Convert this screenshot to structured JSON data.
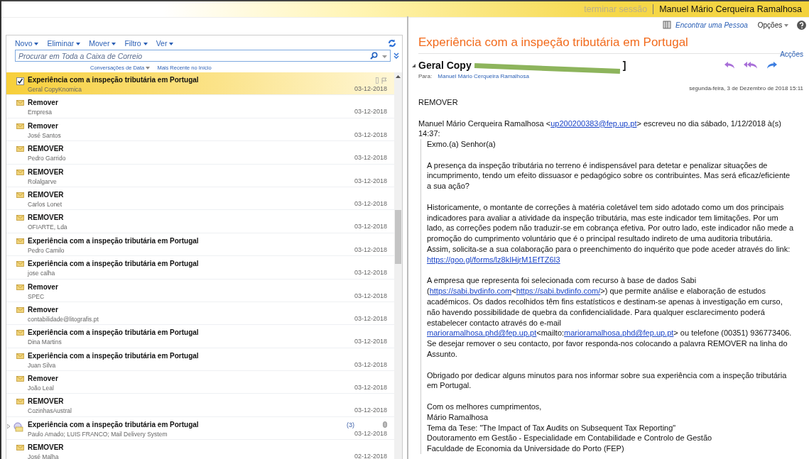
{
  "top_bar": {
    "sign_out": "terminar sessão",
    "user": "Manuel Mário Cerqueira Ramalhosa"
  },
  "header_links": {
    "find_person": "Encontrar uma Pessoa",
    "options": "Opções"
  },
  "toolbar": [
    "Novo",
    "Eliminar",
    "Mover",
    "Filtro",
    "Ver"
  ],
  "search": {
    "placeholder": "Procurar em Toda a Caixa de Correio"
  },
  "sort": {
    "arrange": "Conversações de Data",
    "order": "Mais Recente no Início"
  },
  "messages": [
    {
      "kind": "mail",
      "selected": true,
      "subject": "Experiência com a inspeção tributária em Portugal",
      "from": "Geral CopyKnomica",
      "date": "03-12-2018"
    },
    {
      "kind": "mail",
      "selected": false,
      "subject": "Remover",
      "from": "Empresa",
      "date": "03-12-2018"
    },
    {
      "kind": "mail",
      "selected": false,
      "subject": "Remover",
      "from": "José Santos",
      "date": "03-12-2018"
    },
    {
      "kind": "mail",
      "selected": false,
      "subject": "REMOVER",
      "from": "Pedro Garrido",
      "date": "03-12-2018"
    },
    {
      "kind": "mail",
      "selected": false,
      "subject": "REMOVER",
      "from": "Rolalgarve",
      "date": "03-12-2018"
    },
    {
      "kind": "mail",
      "selected": false,
      "subject": "REMOVER",
      "from": "Carlos Lonet",
      "date": "03-12-2018"
    },
    {
      "kind": "mail",
      "selected": false,
      "subject": "REMOVER",
      "from": "OFIARTE, Lda",
      "date": "03-12-2018"
    },
    {
      "kind": "mail",
      "selected": false,
      "subject": "Experiência com a inspeção tributária em Portugal",
      "from": "Pedro Camilo",
      "date": "03-12-2018"
    },
    {
      "kind": "mail",
      "selected": false,
      "subject": "Experiência com a inspeção tributária em Portugal",
      "from": "jose calha",
      "date": "03-12-2018"
    },
    {
      "kind": "mail",
      "selected": false,
      "subject": "Remover",
      "from": "SPEC",
      "date": "03-12-2018"
    },
    {
      "kind": "mail",
      "selected": false,
      "subject": "Remover",
      "from": "contabilidade@litografis.pt",
      "date": "03-12-2018"
    },
    {
      "kind": "mail",
      "selected": false,
      "subject": "Experiência com a inspeção tributária em Portugal",
      "from": "Dina Martins",
      "date": "03-12-2018"
    },
    {
      "kind": "mail",
      "selected": false,
      "subject": "Experiência com a inspeção tributária em Portugal",
      "from": "Juan Silva",
      "date": "03-12-2018"
    },
    {
      "kind": "mail",
      "selected": false,
      "subject": "Remover",
      "from": "João Leal",
      "date": "03-12-2018"
    },
    {
      "kind": "mail",
      "selected": false,
      "subject": "REMOVER",
      "from": "CozinhasAustral",
      "date": "03-12-2018"
    },
    {
      "kind": "conversation",
      "selected": false,
      "subject": "Experiência com a inspeção tributária em Portugal",
      "from": "Paulo Amado; LUIS FRANCO; Mail Delivery System",
      "date": "03-12-2018",
      "count": "(3)"
    },
    {
      "kind": "mail",
      "selected": false,
      "subject": "REMOVER",
      "from": "José Malha",
      "date": "02-12-2018"
    }
  ],
  "reading_pane": {
    "title": "Experiência com a inspeção tributária em Portugal",
    "actions": "Acções",
    "sender": "Geral Copy",
    "sender_end": "]",
    "to_label": "Para:",
    "to": "Manuel Mário Cerqueira Ramalhosa",
    "date": "segunda-feira, 3 de Dezembro de 2018 15:11",
    "intro": [
      [
        {
          "text": "REMOVER"
        }
      ],
      [
        {
          "text": "Manuel Mário Cerqueira Ramalhosa <"
        },
        {
          "link": "up200200383@fep.up.pt"
        },
        {
          "text": "> escreveu no dia sábado, 1/12/2018 à(s) 14:37:"
        }
      ]
    ],
    "quote": [
      [
        {
          "text": "Exmo.(a) Senhor(a)"
        }
      ],
      [
        {
          "text": "A presença da inspeção tributária no terreno é indispensável para detetar e penalizar situações de incumprimento, tendo um efeito dissuasor e pedagógico sobre os contribuintes. Mas será eficaz/eficiente a sua ação?"
        }
      ],
      [
        {
          "text": "Historicamente, o montante de correções à matéria coletável tem sido adotado como um dos principais indicadores para avaliar a atividade da inspeção tributária, mas este indicador tem limitações. Por um lado, as correções podem não traduzir-se em cobrança efetiva. Por outro lado, este indicador não mede a promoção do cumprimento voluntário que é o principal resultado indireto de uma auditoria tributária. Assim, solicita-se a sua colaboração para o preenchimento do inquérito que pode aceder através do link: "
        },
        {
          "link": "https://goo.gl/forms/lz8kIHjrM1EfTZ6I3"
        }
      ],
      [
        {
          "text": "A empresa que representa foi selecionada com recurso à base de dados Sabi ("
        },
        {
          "link": "https://sabi.bvdinfo.com"
        },
        {
          "text": "<"
        },
        {
          "link": "https://sabi.bvdinfo.com/"
        },
        {
          "text": ">) que permite análise e elaboração de estudos académicos. Os dados recolhidos têm fins estatísticos e destinam-se apenas à investigação em curso, não havendo possibilidade de quebra da confidencialidade. Para qualquer esclarecimento poderá estabelecer contacto através do e-mail "
        },
        {
          "link": "marioramalhosa.phd@fep.up.pt"
        },
        {
          "text": "<mailto:"
        },
        {
          "link": "marioramalhosa.phd@fep.up.pt"
        },
        {
          "text": "> ou telefone (00351) 936773406. Se desejar remover o seu contacto, por favor responda-nos colocando a palavra REMOVER na linha do Assunto."
        }
      ],
      [
        {
          "text": "Obrigado por dedicar alguns minutos para nos informar sobre sua experiência com a inspeção tributária em Portugal."
        }
      ]
    ],
    "signature": [
      "Com os melhores cumprimentos,",
      "Mário Ramalhosa",
      "Tema da Tese: \"The Impact of Tax Audits on Subsequent Tax Reporting\"",
      "Doutoramento em Gestão - Especialidade em Contabilidade e Controlo de Gestão",
      "Faculdade de Economia da Universidade do Porto (FEP)"
    ]
  }
}
